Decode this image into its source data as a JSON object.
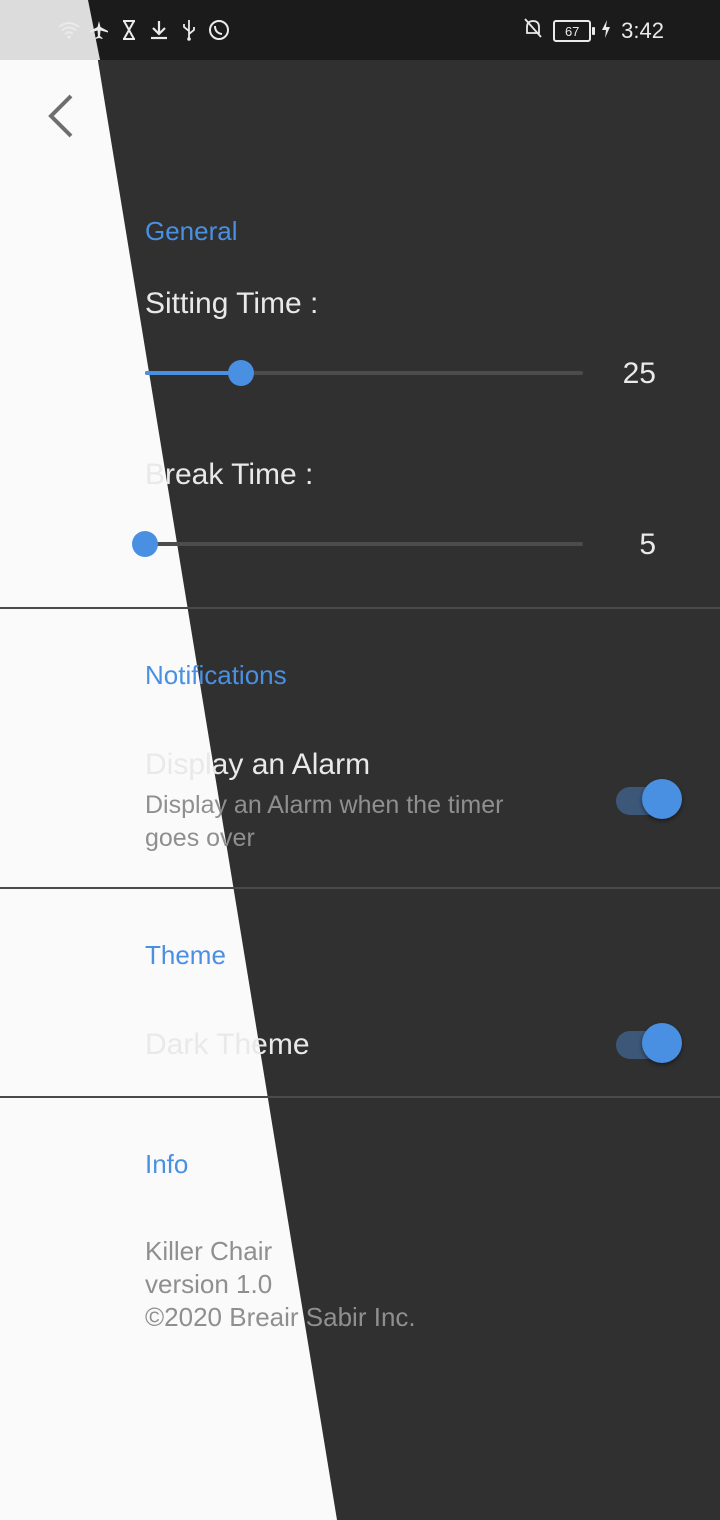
{
  "status_bar": {
    "time": "3:42",
    "battery": "67",
    "left_icons": [
      "wifi-icon",
      "airplane-icon",
      "hourglass-icon",
      "download-icon",
      "usb-icon",
      "whatsapp-icon"
    ],
    "right_icons": [
      "notifications-off-icon",
      "battery-icon",
      "charging-icon"
    ]
  },
  "colors": {
    "accent": "#4a90e2",
    "background_dark": "#303030",
    "background_light": "#fafafa",
    "divider": "#4a4a4a"
  },
  "general": {
    "title": "General",
    "sitting_label": "Sitting Time :",
    "sitting_value": "25",
    "sitting_fraction": 0.22,
    "break_label": "Break Time :",
    "break_value": "5",
    "break_fraction": 0.0
  },
  "notifications": {
    "title": "Notifications",
    "alarm_label": "Display an Alarm",
    "alarm_desc_line1": "Display an Alarm when the timer",
    "alarm_desc_line2": "goes over",
    "alarm_on": true
  },
  "theme": {
    "title": "Theme",
    "dark_label": "Dark Theme",
    "dark_on": true
  },
  "info": {
    "title": "Info",
    "app_name": "Killer Chair",
    "version": "version 1.0",
    "copyright": "©2020 Breair Sabir Inc."
  }
}
